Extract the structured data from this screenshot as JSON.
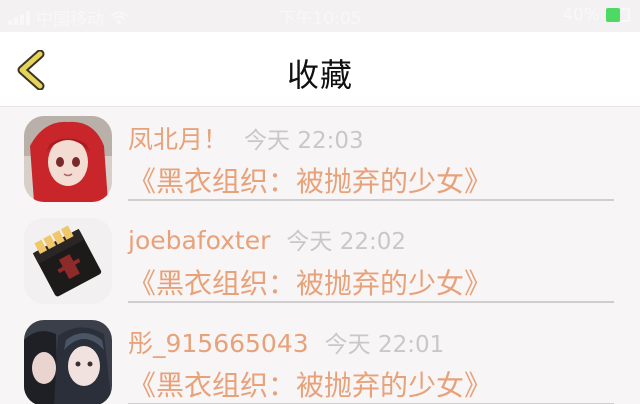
{
  "status_bar": {
    "carrier": "中国移动",
    "time": "下午10:05",
    "battery": "40%",
    "icons": [
      "signal-icon",
      "wifi-icon",
      "battery-icon"
    ]
  },
  "navbar": {
    "title": "收藏",
    "back_icon": "chevron-left-icon"
  },
  "colors": {
    "accent": "#e8a27a",
    "muted": "#c9c7c8",
    "back_icon": "#e6d35a"
  },
  "favorites": [
    {
      "name": "凤北月！",
      "time": "今天 22:03",
      "work": "《黑衣组织：被抛弃的少女》"
    },
    {
      "name": "joebafoxter",
      "time": "今天 22:02",
      "work": "《黑衣组织：被抛弃的少女》"
    },
    {
      "name": "彤_915665043",
      "time": "今天 22:01",
      "work": "《黑衣组织：被抛弃的少女》"
    }
  ]
}
